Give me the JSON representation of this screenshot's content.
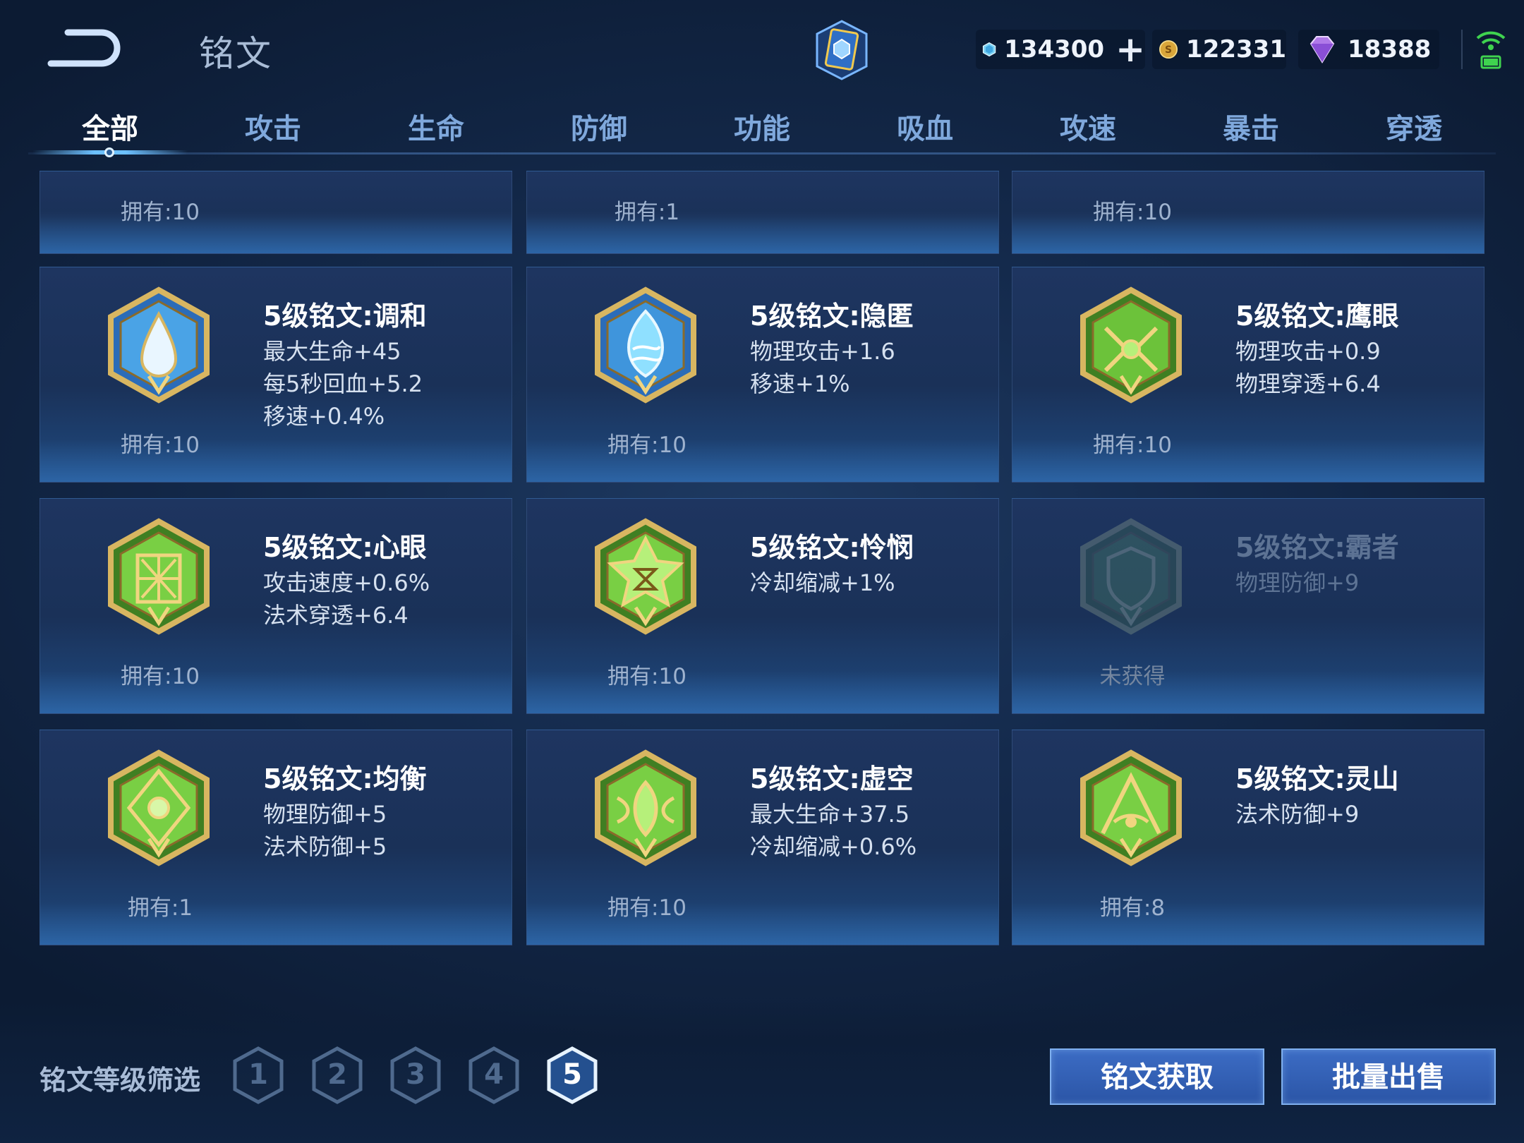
{
  "header": {
    "title": "铭文",
    "back_icon": "back-arrow-icon",
    "currencies": [
      {
        "name": "diamond",
        "icon": "diamond-icon",
        "amount": "134300"
      },
      {
        "name": "gold",
        "icon": "gold-coin-icon",
        "amount": "122331"
      },
      {
        "name": "gem",
        "icon": "purple-gem-icon",
        "amount": "18388"
      }
    ]
  },
  "tabs": [
    {
      "label": "全部",
      "active": true
    },
    {
      "label": "攻击"
    },
    {
      "label": "生命"
    },
    {
      "label": "防御"
    },
    {
      "label": "功能"
    },
    {
      "label": "吸血"
    },
    {
      "label": "攻速"
    },
    {
      "label": "暴击"
    },
    {
      "label": "穿透"
    }
  ],
  "top_row_partial": [
    {
      "owned": "拥有:10"
    },
    {
      "owned": "拥有:1"
    },
    {
      "owned": "拥有:10"
    }
  ],
  "runes": [
    {
      "name": "5级铭文:调和",
      "stats": [
        "最大生命+45",
        "每5秒回血+5.2",
        "移速+0.4%"
      ],
      "owned": "拥有:10",
      "color": "blue",
      "icon": "teardrop-rune-icon"
    },
    {
      "name": "5级铭文:隐匿",
      "stats": [
        "物理攻击+1.6",
        "移速+1%"
      ],
      "owned": "拥有:10",
      "color": "blue",
      "icon": "flame-rune-icon"
    },
    {
      "name": "5级铭文:鹰眼",
      "stats": [
        "物理攻击+0.9",
        "物理穿透+6.4"
      ],
      "owned": "拥有:10",
      "color": "green",
      "icon": "eagle-rune-icon"
    },
    {
      "name": "5级铭文:心眼",
      "stats": [
        "攻击速度+0.6%",
        "法术穿透+6.4"
      ],
      "owned": "拥有:10",
      "color": "green",
      "icon": "eye-rune-icon"
    },
    {
      "name": "5级铭文:怜悯",
      "stats": [
        "冷却缩减+1%"
      ],
      "owned": "拥有:10",
      "color": "green",
      "icon": "hourglass-rune-icon"
    },
    {
      "name": "5级铭文:霸者",
      "stats": [
        "物理防御+9"
      ],
      "owned": "未获得",
      "color": "green",
      "icon": "shield-rune-icon",
      "dim": true
    },
    {
      "name": "5级铭文:均衡",
      "stats": [
        "物理防御+5",
        "法术防御+5"
      ],
      "owned": "拥有:1",
      "color": "green",
      "icon": "compass-rune-icon"
    },
    {
      "name": "5级铭文:虚空",
      "stats": [
        "最大生命+37.5",
        "冷却缩减+0.6%"
      ],
      "owned": "拥有:10",
      "color": "green",
      "icon": "void-rune-icon"
    },
    {
      "name": "5级铭文:灵山",
      "stats": [
        "法术防御+9"
      ],
      "owned": "拥有:8",
      "color": "green",
      "icon": "mountain-rune-icon"
    }
  ],
  "footer": {
    "filter_label": "铭文等级筛选",
    "levels": [
      "1",
      "2",
      "3",
      "4",
      "5"
    ],
    "active_level": "5",
    "get_button": "铭文获取",
    "sell_button": "批量出售"
  },
  "colors": {
    "background": "#142a4c",
    "tab_active": "#ffffff",
    "tab_inactive": "#7fa8dc",
    "button": "#2f5bb0",
    "badge_green": "#6cc23a",
    "badge_blue": "#3d8fd8",
    "gold_frame": "#c9a44e"
  }
}
